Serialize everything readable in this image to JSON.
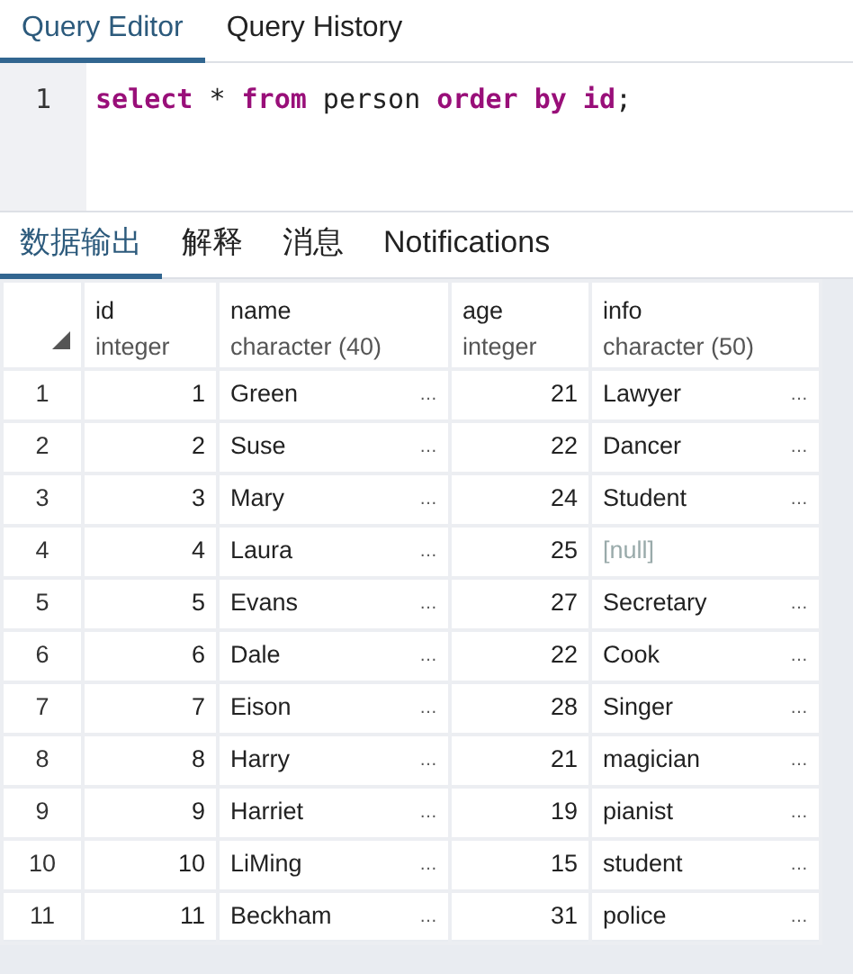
{
  "editor_tabs": [
    {
      "label": "Query Editor",
      "selected": true
    },
    {
      "label": "Query History",
      "selected": false
    }
  ],
  "editor": {
    "line_number": "1",
    "tokens": [
      {
        "text": "select",
        "kind": "keyword"
      },
      {
        "text": " * ",
        "kind": "plain"
      },
      {
        "text": "from",
        "kind": "keyword"
      },
      {
        "text": " person ",
        "kind": "plain"
      },
      {
        "text": "order by id",
        "kind": "keyword"
      },
      {
        "text": ";",
        "kind": "plain"
      }
    ]
  },
  "output_tabs": [
    {
      "label": "数据输出",
      "selected": true
    },
    {
      "label": "解释",
      "selected": false
    },
    {
      "label": "消息",
      "selected": false
    },
    {
      "label": "Notifications",
      "selected": false
    }
  ],
  "table": {
    "columns": [
      {
        "name": "id",
        "type": "integer",
        "kind": "number"
      },
      {
        "name": "name",
        "type": "character (40)",
        "kind": "text"
      },
      {
        "name": "age",
        "type": "integer",
        "kind": "number"
      },
      {
        "name": "info",
        "type": "character (50)",
        "kind": "text"
      }
    ],
    "rows": [
      {
        "row_number": "1",
        "cells": [
          {
            "value": "1"
          },
          {
            "value": "Green",
            "expand": "…"
          },
          {
            "value": "21"
          },
          {
            "value": "Lawyer",
            "expand": "…"
          }
        ]
      },
      {
        "row_number": "2",
        "cells": [
          {
            "value": "2"
          },
          {
            "value": "Suse",
            "expand": "…"
          },
          {
            "value": "22"
          },
          {
            "value": "Dancer",
            "expand": "…"
          }
        ]
      },
      {
        "row_number": "3",
        "cells": [
          {
            "value": "3"
          },
          {
            "value": "Mary",
            "expand": "…"
          },
          {
            "value": "24"
          },
          {
            "value": "Student",
            "expand": "…"
          }
        ]
      },
      {
        "row_number": "4",
        "cells": [
          {
            "value": "4"
          },
          {
            "value": "Laura",
            "expand": "…"
          },
          {
            "value": "25"
          },
          {
            "value": "[null]",
            "is_null": true
          }
        ]
      },
      {
        "row_number": "5",
        "cells": [
          {
            "value": "5"
          },
          {
            "value": "Evans",
            "expand": "…"
          },
          {
            "value": "27"
          },
          {
            "value": "Secretary",
            "expand": "…"
          }
        ]
      },
      {
        "row_number": "6",
        "cells": [
          {
            "value": "6"
          },
          {
            "value": "Dale",
            "expand": "…"
          },
          {
            "value": "22"
          },
          {
            "value": "Cook",
            "expand": "…"
          }
        ]
      },
      {
        "row_number": "7",
        "cells": [
          {
            "value": "7"
          },
          {
            "value": "Eison",
            "expand": "…"
          },
          {
            "value": "28"
          },
          {
            "value": "Singer",
            "expand": "…"
          }
        ]
      },
      {
        "row_number": "8",
        "cells": [
          {
            "value": "8"
          },
          {
            "value": "Harry",
            "expand": "…"
          },
          {
            "value": "21"
          },
          {
            "value": "magician",
            "expand": "…"
          }
        ]
      },
      {
        "row_number": "9",
        "cells": [
          {
            "value": "9"
          },
          {
            "value": "Harriet",
            "expand": "…"
          },
          {
            "value": "19"
          },
          {
            "value": "pianist",
            "expand": "…"
          }
        ]
      },
      {
        "row_number": "10",
        "cells": [
          {
            "value": "10"
          },
          {
            "value": "LiMing",
            "expand": "…"
          },
          {
            "value": "15"
          },
          {
            "value": "student",
            "expand": "…"
          }
        ]
      },
      {
        "row_number": "11",
        "cells": [
          {
            "value": "11"
          },
          {
            "value": "Beckham",
            "expand": "…"
          },
          {
            "value": "31"
          },
          {
            "value": "police",
            "expand": "…"
          }
        ]
      }
    ]
  }
}
